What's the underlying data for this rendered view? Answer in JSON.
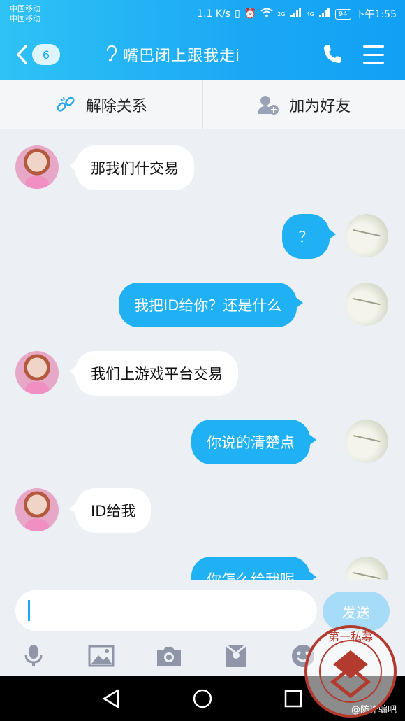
{
  "status": {
    "carrier1": "中国移动",
    "carrier2": "中国移动",
    "speed": "1.1 K/s",
    "net_2g": "2G",
    "net_4g": "4G",
    "battery": "94",
    "time": "下午1:55"
  },
  "header": {
    "back_badge": "6",
    "title": "嘴巴闭上跟我走i"
  },
  "actions": {
    "unlink_label": "解除关系",
    "add_friend_label": "加为好友"
  },
  "messages": [
    {
      "side": "in",
      "text": "那我们什交易"
    },
    {
      "side": "out",
      "text": "？"
    },
    {
      "side": "out",
      "text": "我把ID给你？还是什么"
    },
    {
      "side": "in",
      "text": "我们上游戏平台交易"
    },
    {
      "side": "out",
      "text": "你说的清楚点"
    },
    {
      "side": "in",
      "text": "ID给我"
    },
    {
      "side": "out",
      "text": "你怎么给我呢"
    }
  ],
  "composer": {
    "value": "",
    "send_label": "发送"
  },
  "toolbar": [
    "mic-icon",
    "image-icon",
    "camera-icon",
    "red-packet-icon",
    "emoji-icon"
  ],
  "watermark": {
    "text": "@防诈骗吧",
    "logo_text": "第一私募"
  },
  "colors": {
    "header": "#1aa8f5",
    "bubble_out": "#1fb1f3",
    "bubble_in": "#ffffff",
    "background": "#eceff4"
  }
}
